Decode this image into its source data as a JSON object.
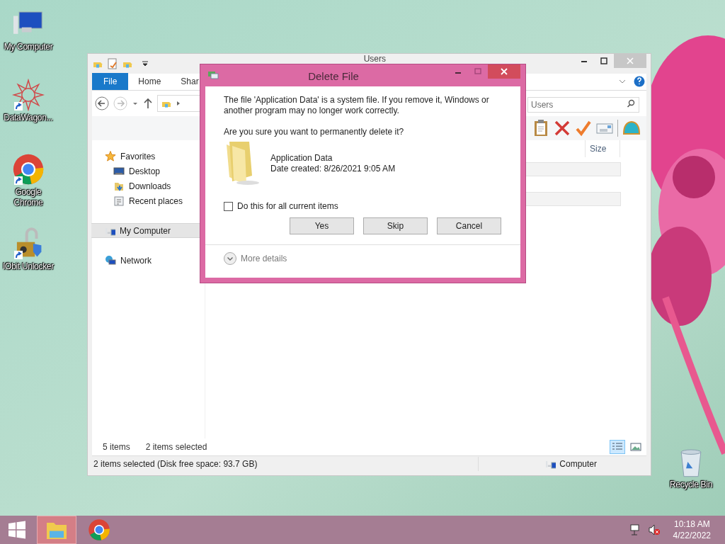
{
  "desktop_icons": [
    {
      "label": "My Computer",
      "kind": "computer",
      "shortcut": false
    },
    {
      "label": "DataWagon...",
      "kind": "star",
      "shortcut": true
    },
    {
      "label": "Google Chrome",
      "kind": "chrome",
      "shortcut": true
    },
    {
      "label": "IObit Unlocker",
      "kind": "lock",
      "shortcut": true
    },
    {
      "label": "Recycle Bin",
      "kind": "bin",
      "shortcut": false
    }
  ],
  "explorer": {
    "title": "Users",
    "tabs": [
      {
        "label": "File",
        "selected": true
      },
      {
        "label": "Home",
        "selected": false
      },
      {
        "label": "Shar",
        "selected": false
      }
    ],
    "search": {
      "placeholder": "Users"
    },
    "columns": [
      "Size"
    ],
    "nav": [
      {
        "label": "Favorites",
        "kind": "star",
        "selected": false,
        "children": [
          {
            "label": "Desktop",
            "kind": "desktop",
            "selected": false
          },
          {
            "label": "Downloads",
            "kind": "downloads",
            "selected": false
          },
          {
            "label": "Recent places",
            "kind": "recent",
            "selected": false
          }
        ]
      },
      {
        "label": "My Computer",
        "kind": "computer",
        "selected": true
      },
      {
        "label": "Network",
        "kind": "network",
        "selected": false
      }
    ],
    "item_count": "5 items",
    "selection_count": "2 items selected",
    "views": [
      {
        "kind": "details",
        "selected": true
      },
      {
        "kind": "thumbnails",
        "selected": false
      }
    ],
    "status_bar": {
      "text": "2 items selected (Disk free space: 93.7 GB)",
      "location": "Computer"
    }
  },
  "dialog": {
    "title": "Delete File",
    "message": "The file 'Application Data' is a system file. If you remove it, Windows or another program may no longer work correctly.",
    "question": "Are you sure you want to permanently delete it?",
    "file": {
      "name": "Application Data",
      "date": "Date created: 8/26/2021 9:05 AM"
    },
    "checkbox": {
      "label": "Do this for all current items",
      "checked": false
    },
    "buttons": [
      "Yes",
      "Skip",
      "Cancel"
    ],
    "more_details": "More details"
  },
  "taskbar": {
    "apps": [
      {
        "kind": "explorer",
        "selected": true
      },
      {
        "kind": "chrome",
        "selected": false
      }
    ],
    "time": "10:18 AM",
    "date": "4/22/2022"
  }
}
